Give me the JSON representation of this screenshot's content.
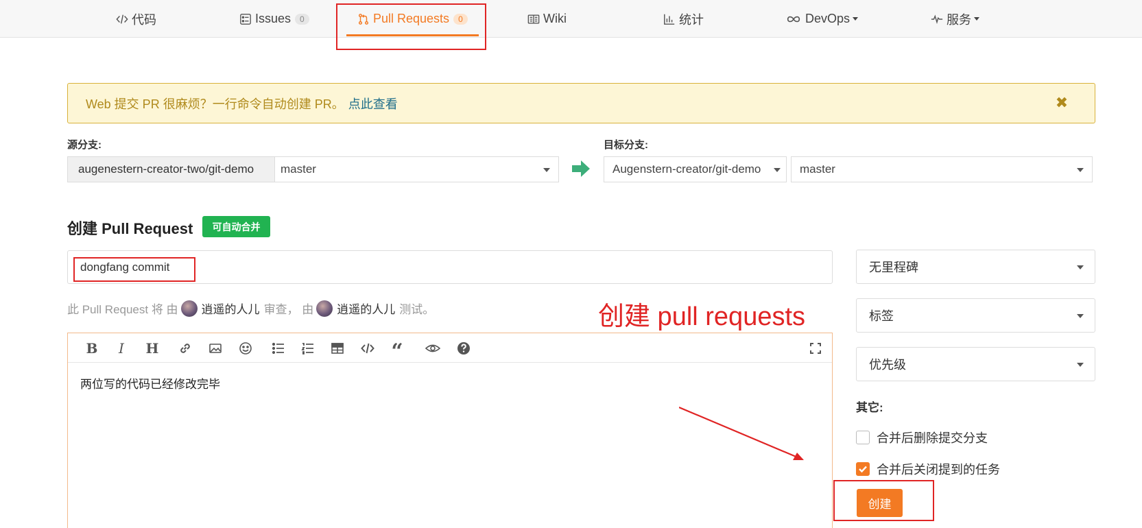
{
  "nav": {
    "tabs": [
      {
        "label": "代码",
        "icon": "code-icon"
      },
      {
        "label": "Issues",
        "icon": "issues-icon",
        "badge": "0"
      },
      {
        "label": "Pull Requests",
        "icon": "pull-request-icon",
        "badge": "0",
        "active": true
      },
      {
        "label": "Wiki",
        "icon": "book-icon"
      },
      {
        "label": "统计",
        "icon": "bar-chart-icon"
      },
      {
        "label": "DevOps",
        "icon": "infinity-icon",
        "dropdown": true
      },
      {
        "label": "服务",
        "icon": "pulse-icon",
        "dropdown": true
      }
    ]
  },
  "notice": {
    "text": "Web 提交 PR 很麻烦？一行命令自动创建 PR。",
    "link": "点此查看",
    "close_icon": "close-icon"
  },
  "branches": {
    "source_label": "源分支:",
    "source_repo": "augenestern-creator-two/git-demo",
    "source_branch": "master",
    "target_label": "目标分支:",
    "target_repo": "Augenstern-creator/git-demo",
    "target_branch": "master"
  },
  "pr": {
    "heading": "创建 Pull Request",
    "merge_badge": "可自动合并",
    "title_value": "dongfang commit",
    "reviewer_prefix": "此 Pull Request 将 由",
    "reviewer_name": "逍遥的人儿",
    "reviewer_suffix": "审查，  由",
    "tester_name": "逍遥的人儿",
    "tester_suffix": "测试。",
    "body": "两位写的代码已经修改完毕"
  },
  "annotation": {
    "text": "创建 pull requests"
  },
  "editor_toolbar": [
    "bold-icon",
    "italic-icon",
    "heading-icon",
    "link-icon",
    "image-icon",
    "emoji-icon",
    "unordered-list-icon",
    "ordered-list-icon",
    "table-icon",
    "code-icon",
    "quote-icon",
    "preview-icon",
    "help-icon",
    "fullscreen-icon"
  ],
  "sidebar": {
    "milestone": "无里程碑",
    "labels": "标签",
    "priority": "优先级",
    "other_label": "其它:",
    "option_delete_branch": "合并后删除提交分支",
    "option_delete_branch_checked": false,
    "option_close_issues": "合并后关闭提到的任务",
    "option_close_issues_checked": true,
    "create_button": "创建"
  },
  "colors": {
    "accent": "#f37a23",
    "success": "#21b351",
    "annotation": "#e02424",
    "notice_bg": "#fdf6d6"
  }
}
